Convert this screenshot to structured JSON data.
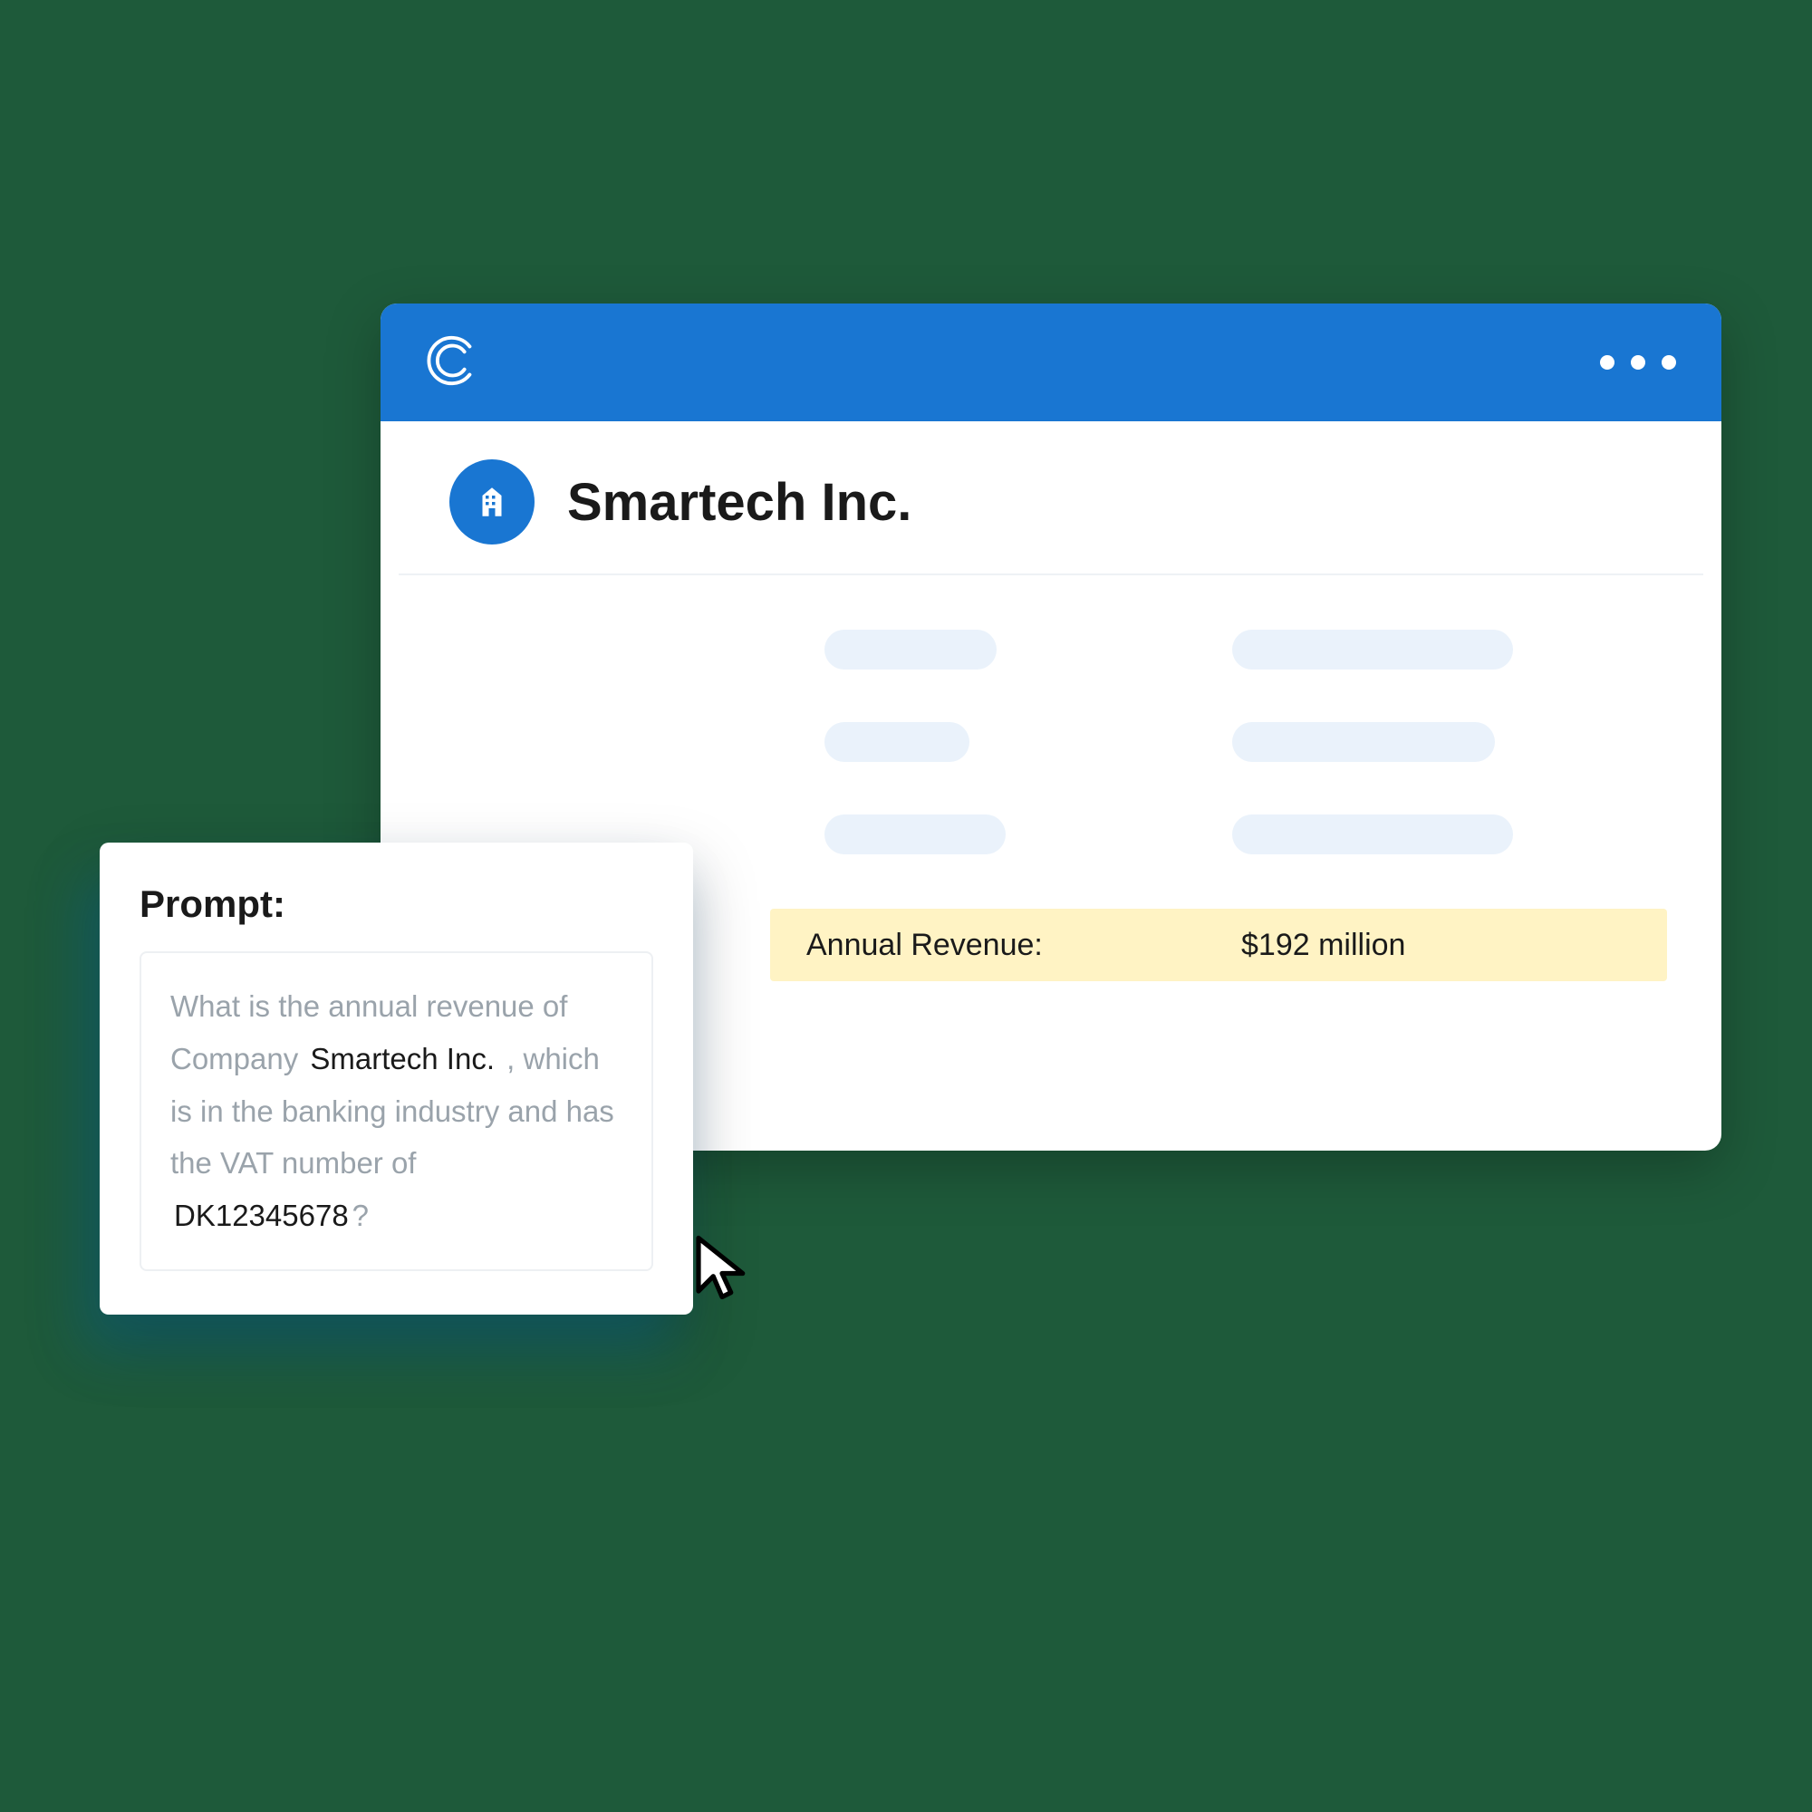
{
  "window": {
    "company_name": "Smartech Inc."
  },
  "revenue": {
    "label": "Annual Revenue:",
    "value": "$192 million"
  },
  "prompt": {
    "title": "Prompt:",
    "seg1": "What is the annual revenue of Company ",
    "var_company": "Smartech Inc.",
    "seg2": " , which is in the banking industry and has the VAT number of ",
    "var_vat": "DK12345678",
    "seg3": "?"
  }
}
